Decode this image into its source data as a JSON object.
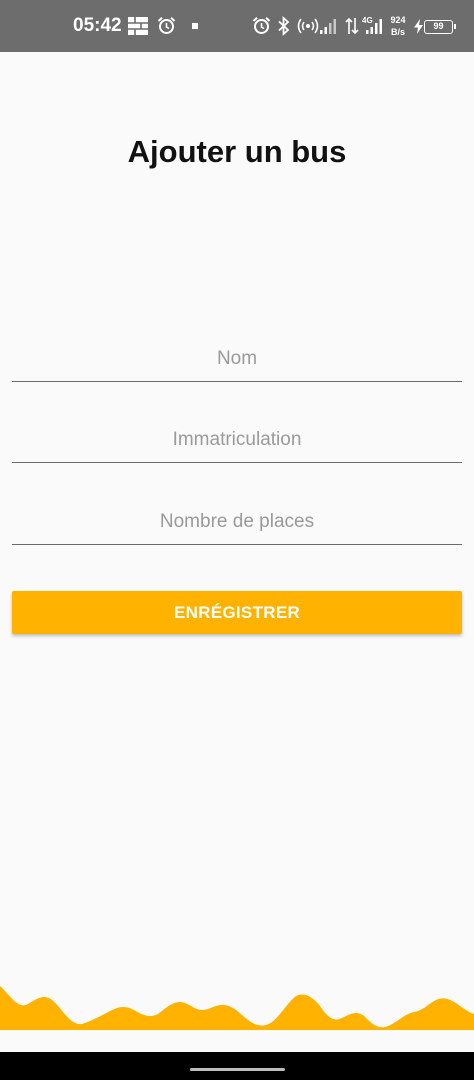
{
  "status_bar": {
    "time": "05:42",
    "network_type": "4G",
    "speed_value": "924",
    "speed_unit": "B/s",
    "battery": "99",
    "icons": [
      "grid-icon",
      "alarm-icon",
      "notification-dot-icon",
      "alarm-icon",
      "bluetooth-icon",
      "hotspot-icon",
      "signal-icon",
      "data-arrows-icon",
      "signal-4g-icon",
      "charging-icon",
      "battery-icon"
    ]
  },
  "page": {
    "title": "Ajouter un bus"
  },
  "form": {
    "name_placeholder": "Nom",
    "registration_placeholder": "Immatriculation",
    "seats_placeholder": "Nombre de places",
    "save_label": "ENRÉGISTRER"
  },
  "colors": {
    "accent": "#ffb300",
    "status_bar": "#6d6d6d",
    "background": "#fafafa"
  }
}
